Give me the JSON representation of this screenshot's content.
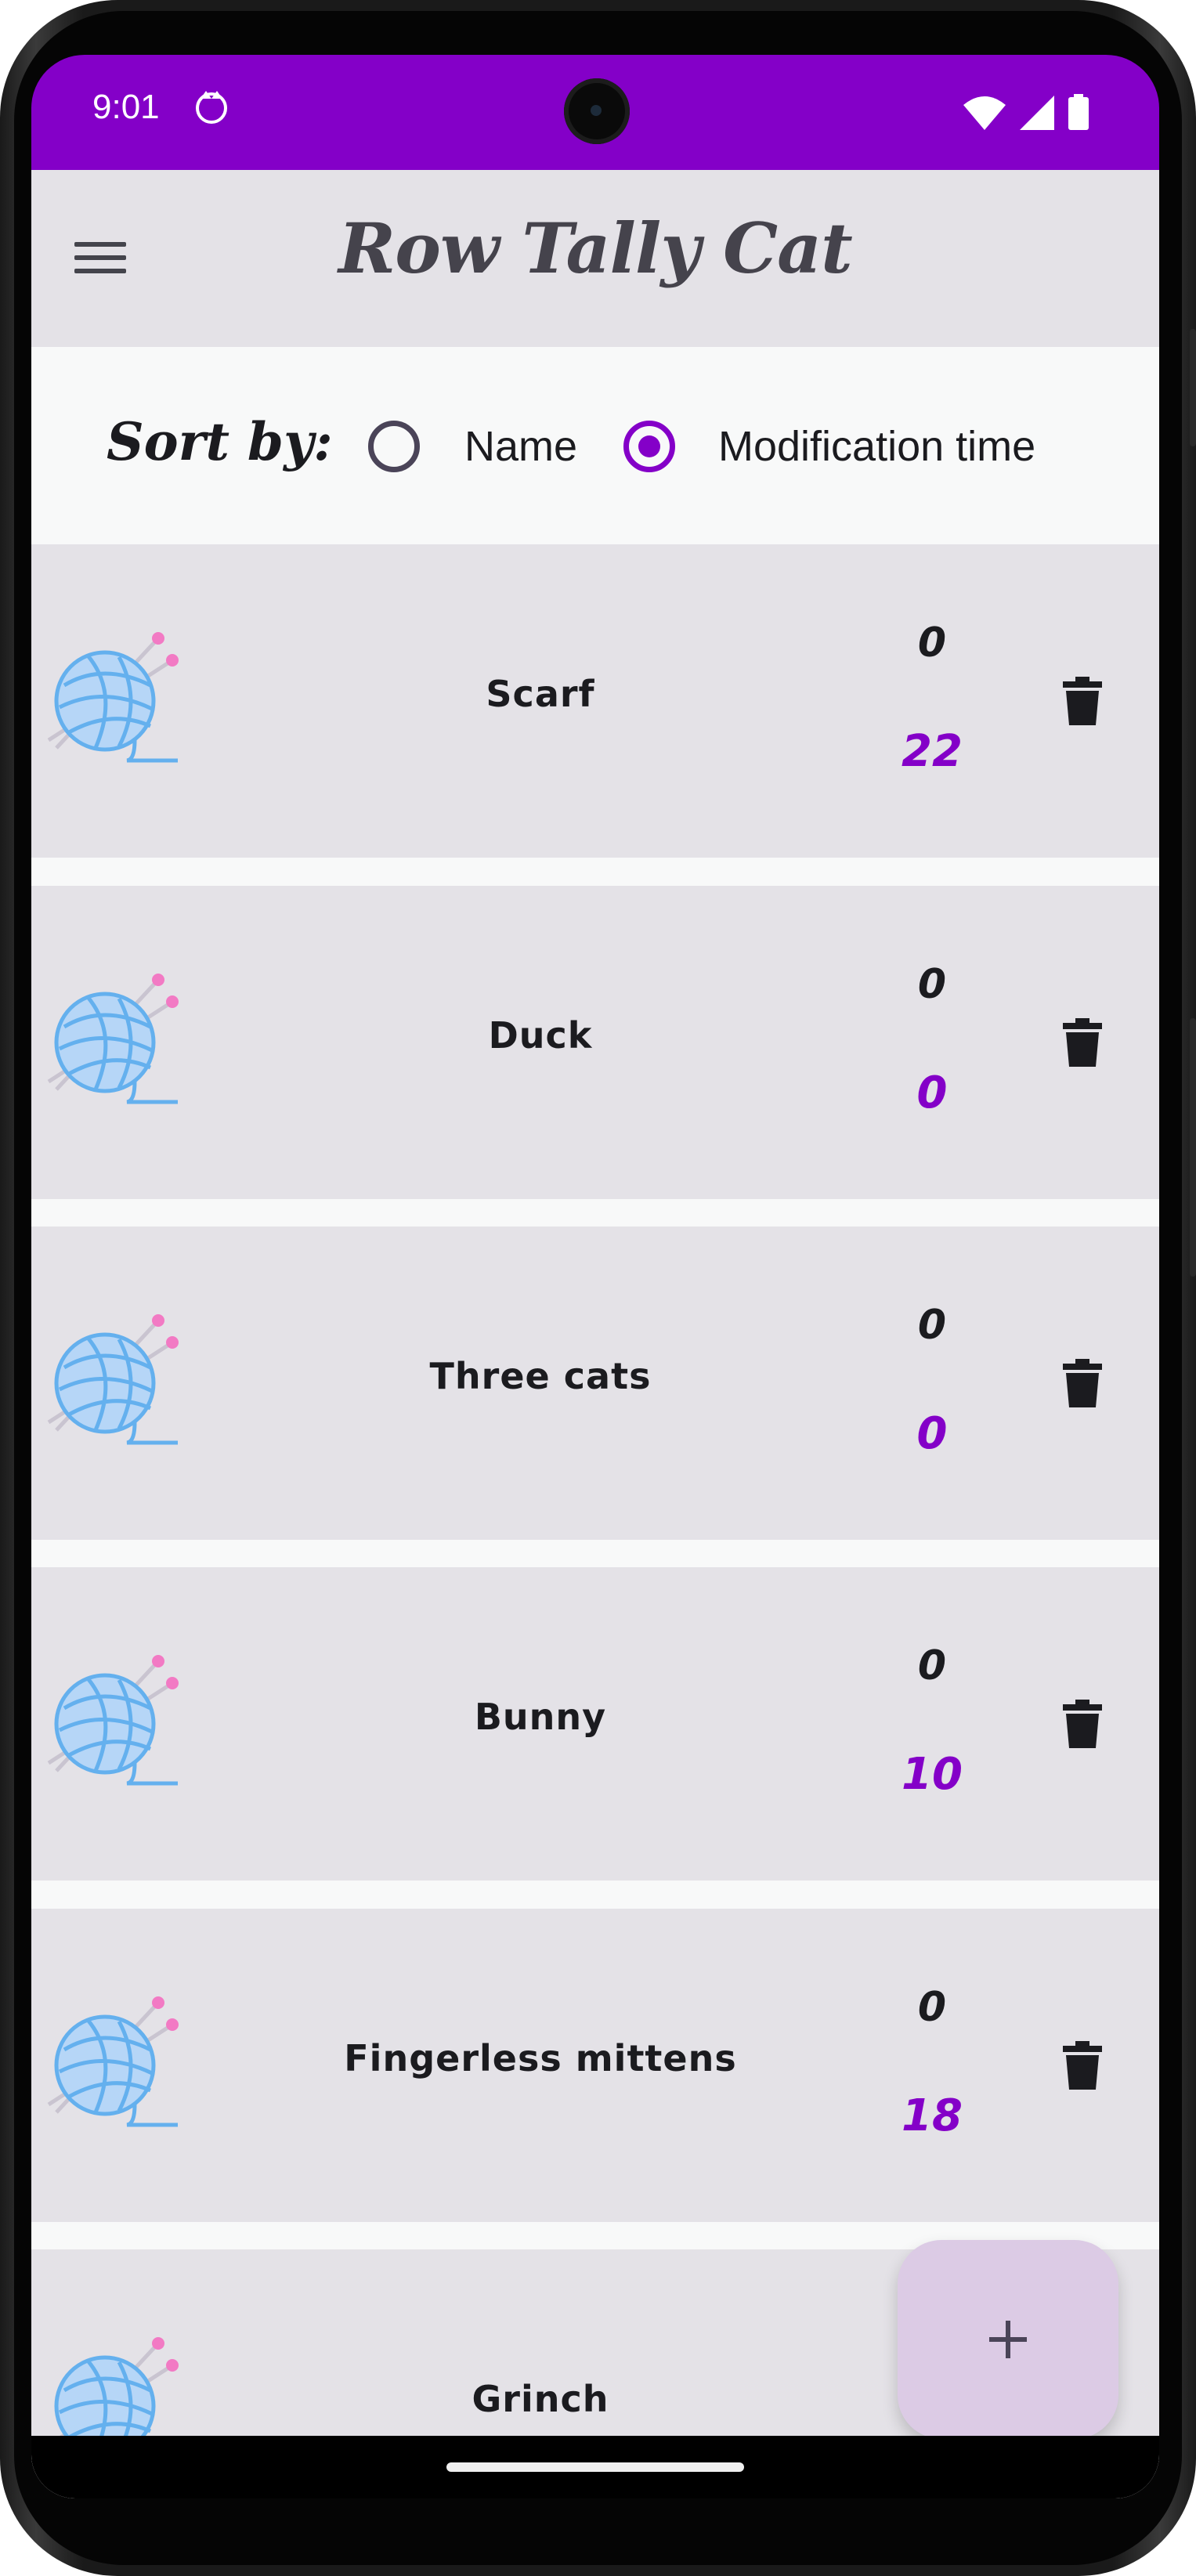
{
  "status_bar": {
    "time": "9:01",
    "background": "#8400c8",
    "icons": [
      "cat-notification-icon",
      "wifi-icon",
      "signal-icon",
      "battery-icon"
    ]
  },
  "app_bar": {
    "title": "Row Tally Cat",
    "menu_icon": "hamburger-menu-icon"
  },
  "sort": {
    "label": "Sort by:",
    "options": [
      {
        "label": "Name",
        "selected": false
      },
      {
        "label": "Modification time",
        "selected": true
      }
    ]
  },
  "projects": [
    {
      "name": "Scarf",
      "rows": "0",
      "total": "22"
    },
    {
      "name": "Duck",
      "rows": "0",
      "total": "0"
    },
    {
      "name": "Three cats",
      "rows": "0",
      "total": "0"
    },
    {
      "name": "Bunny",
      "rows": "0",
      "total": "10"
    },
    {
      "name": "Fingerless mittens",
      "rows": "0",
      "total": "18"
    },
    {
      "name": "Grinch",
      "rows": "",
      "total": ""
    }
  ],
  "fab": {
    "label": "+",
    "icon": "plus-icon"
  },
  "colors": {
    "accent": "#8400c8",
    "card": "#e4e2e7",
    "fab": "#dccbe5"
  }
}
